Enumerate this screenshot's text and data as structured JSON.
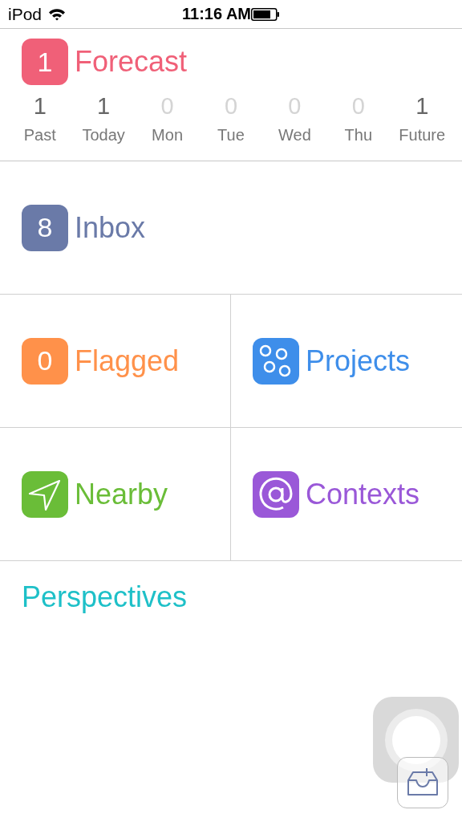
{
  "status_bar": {
    "carrier": "iPod",
    "time": "11:16 AM"
  },
  "forecast": {
    "badge": "1",
    "title": "Forecast",
    "color": "#f06078",
    "days": [
      {
        "count": "1",
        "label": "Past",
        "dimmed": false
      },
      {
        "count": "1",
        "label": "Today",
        "dimmed": false
      },
      {
        "count": "0",
        "label": "Mon",
        "dimmed": true
      },
      {
        "count": "0",
        "label": "Tue",
        "dimmed": true
      },
      {
        "count": "0",
        "label": "Wed",
        "dimmed": true
      },
      {
        "count": "0",
        "label": "Thu",
        "dimmed": true
      },
      {
        "count": "1",
        "label": "Future",
        "dimmed": false
      }
    ]
  },
  "inbox": {
    "kind": "badge",
    "badge": "8",
    "title": "Inbox",
    "color": "#6a7aa8"
  },
  "tiles": [
    {
      "kind": "badge",
      "badge": "0",
      "title": "Flagged",
      "color": "#ff914a"
    },
    {
      "kind": "projects",
      "title": "Projects",
      "color": "#3e8eea"
    },
    {
      "kind": "nearby",
      "title": "Nearby",
      "color": "#6abd38"
    },
    {
      "kind": "contexts",
      "title": "Contexts",
      "color": "#9a58d8"
    }
  ],
  "perspectives": {
    "title": "Perspectives"
  }
}
